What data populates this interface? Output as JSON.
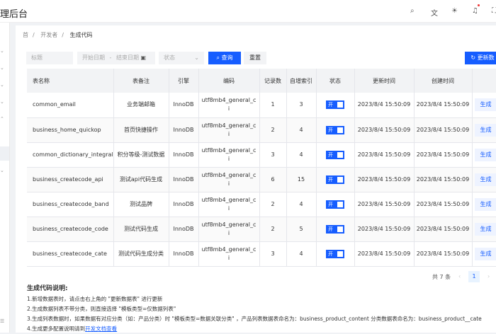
{
  "header": {
    "title": "理后台"
  },
  "sidebar": {
    "bottom_icon": "☰"
  },
  "breadcrumb": [
    "首",
    "开发者",
    "生成代码"
  ],
  "filters": {
    "title_placeholder": "标题",
    "start_placeholder": "开始日期",
    "sep": "-",
    "end_placeholder": "结束日期",
    "status_placeholder": "状态",
    "search": "查询",
    "reset": "重置",
    "refresh": "更新数"
  },
  "table": {
    "headers": [
      "表名称",
      "表备注",
      "引擎",
      "编码",
      "记录数",
      "自增索引",
      "状态",
      "更新时间",
      "创建时间",
      ""
    ],
    "rows": [
      {
        "name": "common_email",
        "comment": "业务端邮箱",
        "engine": "InnoDB",
        "enc": "utf8mb4_general_ci",
        "records": "1",
        "auto": "3",
        "status": "开",
        "updated": "2023/8/4 15:50:09",
        "created": "2023/8/4 15:50:09",
        "action": "生成"
      },
      {
        "name": "business_home_quickop",
        "comment": "首页快捷操作",
        "engine": "InnoDB",
        "enc": "utf8mb4_general_ci",
        "records": "2",
        "auto": "4",
        "status": "开",
        "updated": "2023/8/4 15:50:09",
        "created": "2023/8/4 15:50:09",
        "action": "生成"
      },
      {
        "name": "common_dictionary_integral",
        "comment": "积分等级-测试数据",
        "engine": "InnoDB",
        "enc": "utf8mb4_general_ci",
        "records": "3",
        "auto": "4",
        "status": "开",
        "updated": "2023/8/4 15:50:09",
        "created": "2023/8/4 15:50:09",
        "action": "生成"
      },
      {
        "name": "business_createcode_api",
        "comment": "测试api代码生成",
        "engine": "InnoDB",
        "enc": "utf8mb4_general_ci",
        "records": "6",
        "auto": "15",
        "status": "开",
        "updated": "2023/8/4 15:50:09",
        "created": "2023/8/4 15:50:09",
        "action": "生成"
      },
      {
        "name": "business_createcode_band",
        "comment": "测试品牌",
        "engine": "InnoDB",
        "enc": "utf8mb4_general_ci",
        "records": "2",
        "auto": "4",
        "status": "开",
        "updated": "2023/8/4 15:50:09",
        "created": "2023/8/4 15:50:09",
        "action": "生成"
      },
      {
        "name": "business_createcode_code",
        "comment": "测试代码生成",
        "engine": "InnoDB",
        "enc": "utf8mb4_general_ci",
        "records": "2",
        "auto": "5",
        "status": "开",
        "updated": "2023/8/4 15:50:09",
        "created": "2023/8/4 15:50:09",
        "action": "生成"
      },
      {
        "name": "business_createcode_cate",
        "comment": "测试代码生成分类",
        "engine": "InnoDB",
        "enc": "utf8mb4_general_ci",
        "records": "3",
        "auto": "4",
        "status": "开",
        "updated": "2023/8/4 15:50:09",
        "created": "2023/8/4 15:50:09",
        "action": "生成"
      }
    ]
  },
  "pagination": {
    "total": "共 7 条",
    "prev": "‹",
    "page": "1",
    "next": "›"
  },
  "notes": {
    "title": "生成代码说明:",
    "lines": [
      "1.新增数据表时，请点击右上角的 \"更新数据表\" 进行更新",
      "2.生成数据列表不带分类，则直接选择 \"模板类型=仅数据列表\"",
      "3.生成列表数据时，如果数据有对应分类（如：产品分类）时 \"模板类型=数据关联分类\" ，产品列表数据表命名为：business_product_content 分类数据表命名为：business_product__cate"
    ],
    "line4_prefix": "4.生成更多配置说明请到",
    "line4_link": "开发文档查看"
  }
}
